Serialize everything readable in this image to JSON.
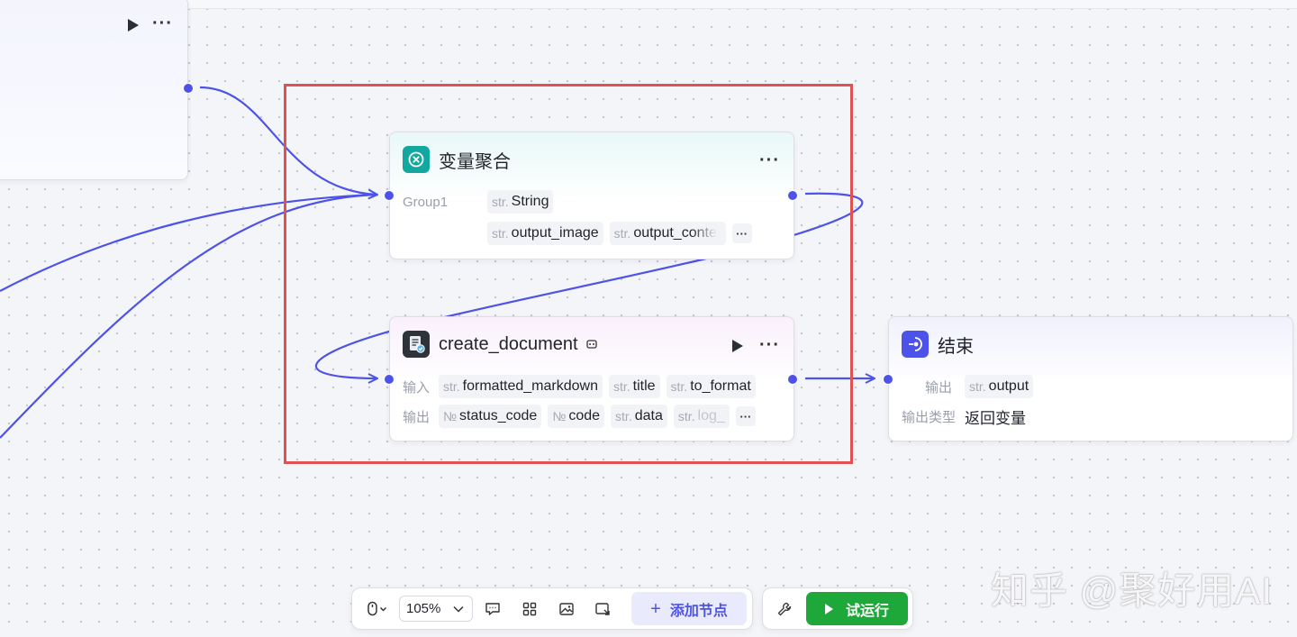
{
  "canvas": {
    "edge_color": "#4d53e8",
    "highlight_color": "#e05252"
  },
  "variable_aggregator": {
    "title": "变量聚合",
    "icon": "variable-aggregate-icon",
    "icon_color": "#12a8a0",
    "group_label": "Group1",
    "group_tags": [
      {
        "type": "str.",
        "name": "String"
      },
      {
        "type": "str.",
        "name": "output_image"
      },
      {
        "type": "str.",
        "name": "output_conte"
      }
    ],
    "more": "···"
  },
  "create_document": {
    "title": "create_document",
    "icon": "document-plugin-icon",
    "input_label": "输入",
    "inputs": [
      {
        "type": "str.",
        "name": "formatted_markdown"
      },
      {
        "type": "str.",
        "name": "title"
      },
      {
        "type": "str.",
        "name": "to_format"
      }
    ],
    "output_label": "输出",
    "outputs": [
      {
        "type": "№",
        "name": "status_code"
      },
      {
        "type": "№",
        "name": "code"
      },
      {
        "type": "str.",
        "name": "data"
      },
      {
        "type": "str.",
        "name": "log_"
      }
    ],
    "more": "···"
  },
  "end_node": {
    "title": "结束",
    "icon": "end-node-icon",
    "icon_color": "#4d53e8",
    "output_label": "输出",
    "outputs": [
      {
        "type": "str.",
        "name": "output"
      }
    ],
    "output_type_label": "输出类型",
    "output_type_value": "返回变量"
  },
  "toolbar": {
    "zoom": "105%",
    "add_node_label": "添加节点",
    "test_run_label": "试运行",
    "test_run_color": "#1fa83a"
  },
  "watermark": "知乎 @聚好用AI"
}
